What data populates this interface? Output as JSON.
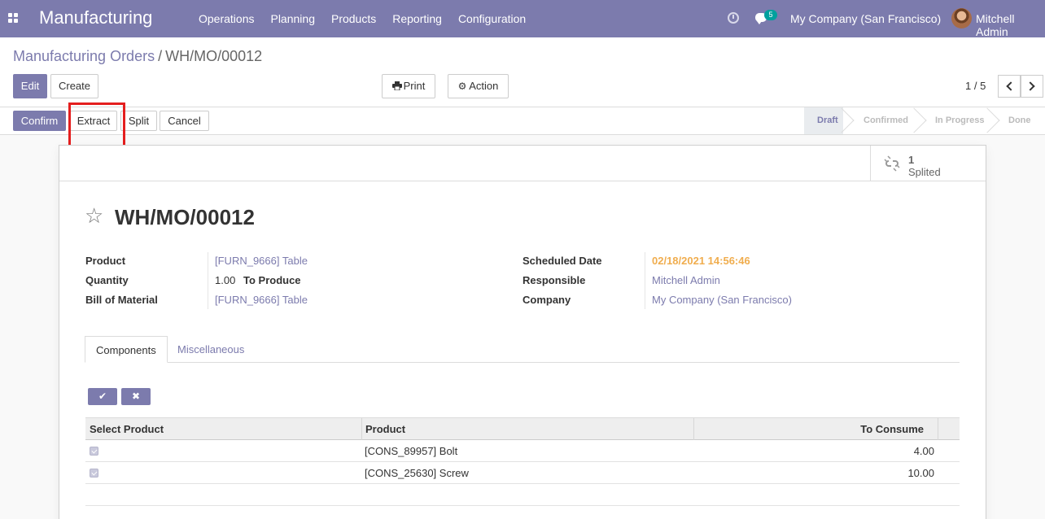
{
  "navbar": {
    "app_name": "Manufacturing",
    "menu": [
      "Operations",
      "Planning",
      "Products",
      "Reporting",
      "Configuration"
    ],
    "messages_badge": "5",
    "company": "My Company (San Francisco)",
    "user": "Mitchell Admin",
    "accent_color": "#7c7bad"
  },
  "breadcrumb": {
    "parent": "Manufacturing Orders",
    "separator": "/",
    "current": "WH/MO/00012"
  },
  "toolbar": {
    "edit": "Edit",
    "create": "Create",
    "print": "Print",
    "action": "Action",
    "pager": "1 / 5"
  },
  "statusbar": {
    "buttons": {
      "confirm": "Confirm",
      "extract": "Extract",
      "split": "Split",
      "cancel": "Cancel"
    },
    "stages": [
      "Draft",
      "Confirmed",
      "In Progress",
      "Done"
    ],
    "active_stage": "Draft"
  },
  "smart_button": {
    "count": "1",
    "label": "Splited",
    "icon": "unlink-icon"
  },
  "record": {
    "title": "WH/MO/00012",
    "fields_left": [
      {
        "label": "Product",
        "value": "[FURN_9666] Table"
      },
      {
        "label": "Quantity",
        "value": "1.00",
        "suffix": "To Produce"
      },
      {
        "label": "Bill of Material",
        "value": "[FURN_9666] Table"
      }
    ],
    "fields_right": [
      {
        "label": "Scheduled Date",
        "value": "02/18/2021 14:56:46"
      },
      {
        "label": "Responsible",
        "value": "Mitchell Admin"
      },
      {
        "label": "Company",
        "value": "My Company (San Francisco)"
      }
    ]
  },
  "tabs": [
    "Components",
    "Miscellaneous"
  ],
  "components_table": {
    "headers": [
      "Select Product",
      "Product",
      "To Consume"
    ],
    "rows": [
      {
        "selected": true,
        "product": "[CONS_89957] Bolt",
        "to_consume": "4.00"
      },
      {
        "selected": true,
        "product": "[CONS_25630] Screw",
        "to_consume": "10.00"
      }
    ]
  }
}
